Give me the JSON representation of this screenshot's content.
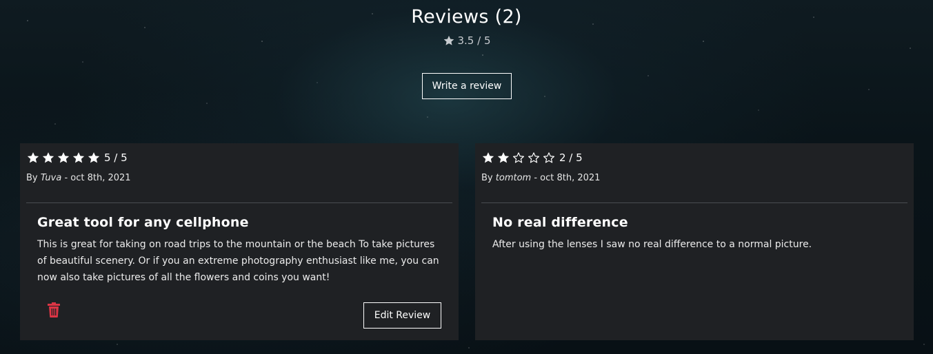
{
  "header": {
    "title": "Reviews (2)",
    "average_rating": "3.5 / 5",
    "write_review_label": "Write a review"
  },
  "colors": {
    "card_background": "#1f2124",
    "delete_icon": "#dc3545",
    "text": "#ffffff"
  },
  "reviews": [
    {
      "rating": 5,
      "rating_text": "5 / 5",
      "by_label": "By",
      "author": "Tuva",
      "date": "- oct 8th, 2021",
      "title": "Great tool for any cellphone",
      "body": "This is great for taking on road trips to the mountain or the beach To take pictures of beautiful scenery. Or if you an extreme photography enthusiast like me, you can now also take pictures of all the flowers and coins you want!",
      "delete_icon": "trash-icon",
      "edit_label": "Edit Review"
    },
    {
      "rating": 2,
      "rating_text": "2 / 5",
      "by_label": "By",
      "author": "tomtom",
      "date": "- oct 8th, 2021",
      "title": "No real difference",
      "body": "After using the lenses I saw no real difference to a normal picture."
    }
  ]
}
